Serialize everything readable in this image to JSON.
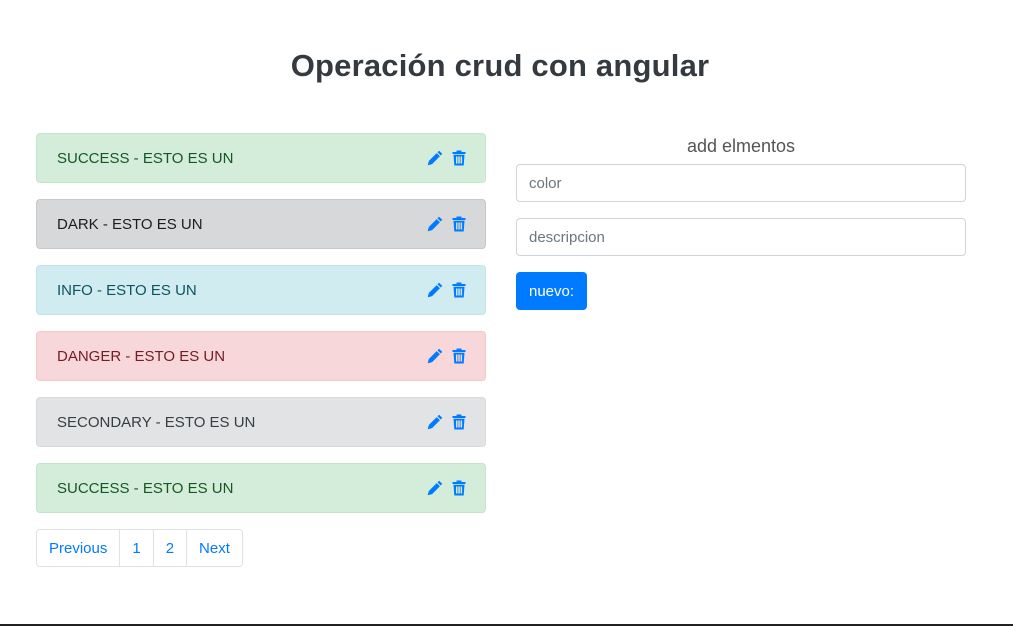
{
  "page": {
    "title": "Operación crud con angular"
  },
  "items": [
    {
      "text": "SUCCESS - ESTO ES UN",
      "variant": "success",
      "edit_icon": "pencil-icon",
      "delete_icon": "trash-icon"
    },
    {
      "text": "DARK - ESTO ES UN",
      "variant": "dark",
      "edit_icon": "pencil-icon",
      "delete_icon": "trash-icon"
    },
    {
      "text": "INFO - ESTO ES UN",
      "variant": "info",
      "edit_icon": "pencil-icon",
      "delete_icon": "trash-icon"
    },
    {
      "text": "DANGER - ESTO ES UN",
      "variant": "danger",
      "edit_icon": "pencil-icon",
      "delete_icon": "trash-icon"
    },
    {
      "text": "SECONDARY - ESTO ES UN",
      "variant": "secondary",
      "edit_icon": "pencil-icon",
      "delete_icon": "trash-icon"
    },
    {
      "text": "SUCCESS - ESTO ES UN",
      "variant": "success",
      "edit_icon": "pencil-icon",
      "delete_icon": "trash-icon"
    }
  ],
  "pagination": {
    "previous": "Previous",
    "pages": [
      "1",
      "2"
    ],
    "next": "Next"
  },
  "form": {
    "title": "add elmentos",
    "color_placeholder": "color",
    "color_value": "",
    "description_placeholder": "descripcion",
    "description_value": "",
    "submit_label": "nuevo:"
  },
  "colors": {
    "primary": "#007bff",
    "icon": "#007bff"
  }
}
